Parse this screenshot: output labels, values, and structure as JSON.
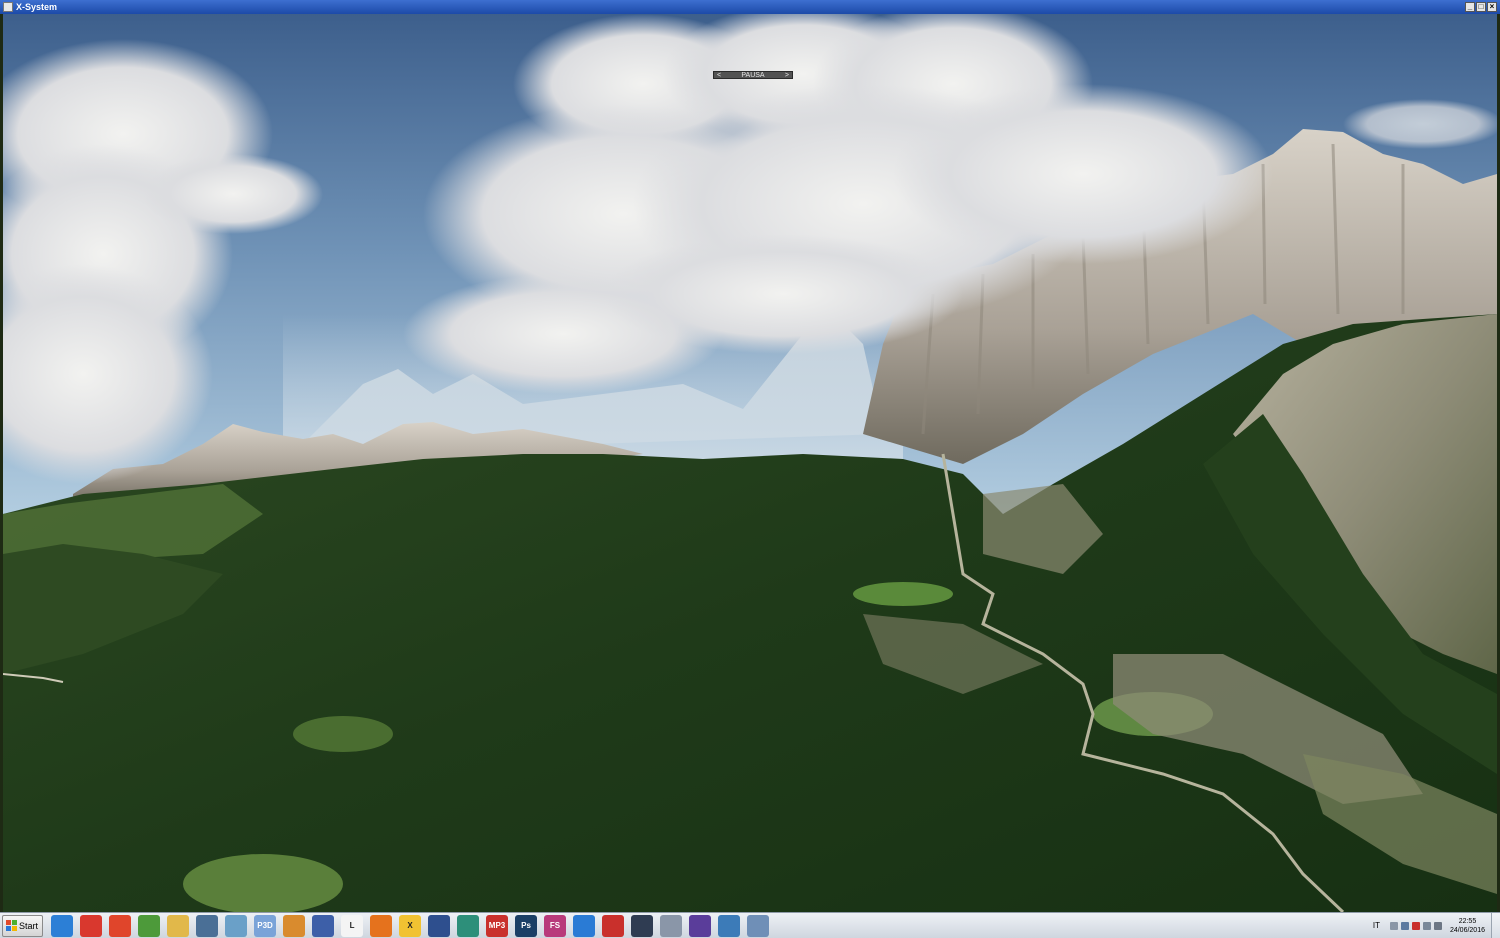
{
  "window": {
    "title": "X-System"
  },
  "simulator": {
    "pause_label": "PAUSA",
    "pause_left": "<",
    "pause_right": ">"
  },
  "taskbar": {
    "start_label": "Start",
    "icons": [
      {
        "name": "internet-explorer-icon",
        "label": "",
        "color": "#2c7fd6"
      },
      {
        "name": "chrome-icon",
        "label": "",
        "color": "#d9382e"
      },
      {
        "name": "red-swirl-icon",
        "label": "",
        "color": "#e0452b"
      },
      {
        "name": "green-figure-icon",
        "label": "",
        "color": "#4d9a3a"
      },
      {
        "name": "folder-icon",
        "label": "",
        "color": "#e1b84a"
      },
      {
        "name": "globe-network-icon",
        "label": "",
        "color": "#4a6f96"
      },
      {
        "name": "cube-icon",
        "label": "",
        "color": "#6aa0c8"
      },
      {
        "name": "p3d-icon",
        "label": "P3D",
        "color": "#7aa3d8"
      },
      {
        "name": "airplane-orange-icon",
        "label": "",
        "color": "#d98b2e"
      },
      {
        "name": "monitor-icon",
        "label": "",
        "color": "#3d5fa8"
      },
      {
        "name": "document-icon",
        "label": "L",
        "color": "#f4f4f4"
      },
      {
        "name": "firefox-icon",
        "label": "",
        "color": "#e5721d"
      },
      {
        "name": "xplane-icon",
        "label": "X",
        "color": "#f1c232"
      },
      {
        "name": "xplane-dvd-icon",
        "label": "",
        "color": "#2e4f8e"
      },
      {
        "name": "helicopter-icon",
        "label": "",
        "color": "#2d8f7a"
      },
      {
        "name": "mp3-icon",
        "label": "MP3",
        "color": "#c9302c"
      },
      {
        "name": "photoshop-icon",
        "label": "Ps",
        "color": "#1b3f66"
      },
      {
        "name": "fs-icon",
        "label": "FS",
        "color": "#b83a7b"
      },
      {
        "name": "airplane-blue-icon",
        "label": "",
        "color": "#2a7bd5"
      },
      {
        "name": "red-feather-icon",
        "label": "",
        "color": "#c9302c"
      },
      {
        "name": "earth-dark-icon",
        "label": "",
        "color": "#2f3c52"
      },
      {
        "name": "node-graph-icon",
        "label": "",
        "color": "#8a96a8"
      },
      {
        "name": "spiral-icon",
        "label": "",
        "color": "#5a3d9a"
      },
      {
        "name": "image-viewer-icon",
        "label": "",
        "color": "#3c7bb8"
      },
      {
        "name": "xsystem-active-icon",
        "label": "",
        "color": "#6f8fb7"
      }
    ],
    "language": "IT",
    "clock_time": "22:55",
    "clock_date": "24/06/2016"
  }
}
